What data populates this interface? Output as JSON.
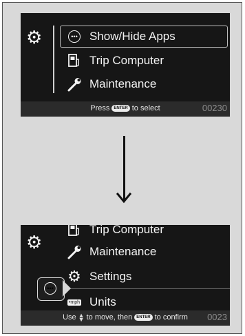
{
  "screen1": {
    "items": [
      {
        "label": "Show/Hide Apps",
        "icon": "apps-circle-icon"
      },
      {
        "label": "Trip Computer",
        "icon": "trip-computer-icon"
      },
      {
        "label": "Maintenance",
        "icon": "wrench-icon"
      }
    ],
    "hint_pre": "Press",
    "enter_label": "ENTER",
    "hint_post": "to select",
    "code": "00230"
  },
  "screen2": {
    "items": [
      {
        "label": "Trip Computer",
        "icon": "trip-computer-icon"
      },
      {
        "label": "Maintenance",
        "icon": "wrench-icon"
      },
      {
        "label": "Settings",
        "icon": "gear-icon"
      },
      {
        "label": "Units",
        "icon": "units-icon"
      }
    ],
    "hint_use": "Use",
    "hint_mid": "to move, then",
    "enter_label": "ENTER",
    "hint_end": "to confirm",
    "code": "0023"
  },
  "icon_glyphs": {
    "apps": "•••",
    "units_badge": "•mph"
  },
  "colors": {
    "screen_bg": "#161616",
    "text": "#f3f3f3",
    "highlight_border": "#bdbdbd"
  }
}
